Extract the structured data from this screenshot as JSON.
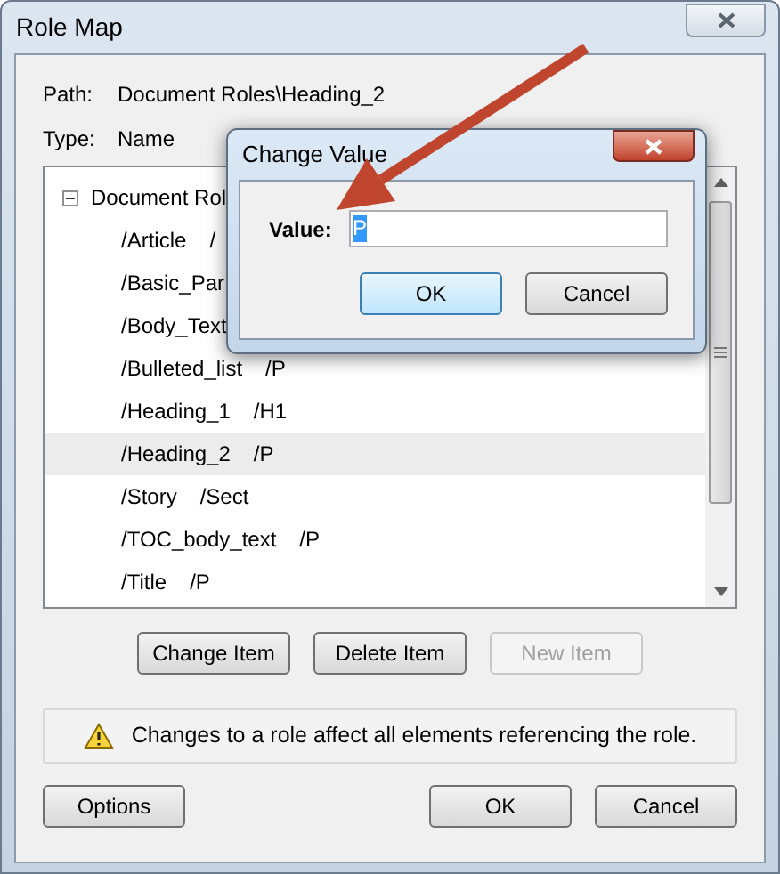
{
  "window": {
    "title": "Role Map"
  },
  "path": {
    "label": "Path:",
    "value": "Document Roles\\Heading_2"
  },
  "type": {
    "label": "Type:",
    "value": "Name"
  },
  "tree": {
    "label": "Document Rol",
    "expanded": true,
    "children": [
      {
        "name": "/Article",
        "role": "/",
        "selected": false
      },
      {
        "name": "/Basic_Par",
        "selected": false
      },
      {
        "name": "/Body_Text",
        "selected": false
      },
      {
        "name": "/Bulleted_list",
        "role": "/P",
        "selected": false
      },
      {
        "name": "/Heading_1",
        "role": "/H1",
        "selected": false
      },
      {
        "name": "/Heading_2",
        "role": "/P",
        "selected": true
      },
      {
        "name": "/Story",
        "role": "/Sect",
        "selected": false
      },
      {
        "name": "/TOC_body_text",
        "role": "/P",
        "selected": false
      },
      {
        "name": "/Title",
        "role": "/P",
        "selected": false
      }
    ]
  },
  "item_buttons": [
    {
      "label": "Change Item",
      "disabled": false
    },
    {
      "label": "Delete Item",
      "disabled": false
    },
    {
      "label": "New Item",
      "disabled": true
    }
  ],
  "warning": "Changes to a role affect all elements referencing the role.",
  "footer_buttons": [
    {
      "label": "Options"
    },
    {
      "label": "OK"
    },
    {
      "label": "Cancel"
    }
  ],
  "dialog": {
    "title": "Change Value",
    "value_label": "Value:",
    "value": "P",
    "value_selected": true,
    "buttons": [
      {
        "label": "OK",
        "default": true
      },
      {
        "label": "Cancel",
        "default": false
      }
    ]
  }
}
